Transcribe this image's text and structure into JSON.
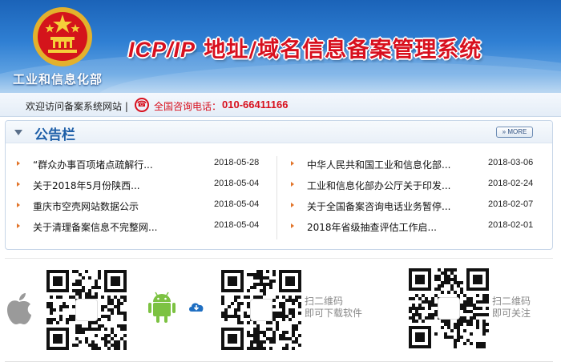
{
  "header": {
    "ministry_name": "工业和信息化部",
    "system_title_latin": "ICP/IP",
    "system_title_cn": " 地址/域名信息备案管理系统"
  },
  "welcome_bar": {
    "text": "欢迎访问备案系统网站 |",
    "hotline_label": "全国咨询电话：",
    "hotline_number": "010-66411166"
  },
  "notice": {
    "title": "公告栏",
    "more_label": "» MORE",
    "left_items": [
      {
        "title": "“群众办事百项堵点疏解行...",
        "date": "2018-05-28"
      },
      {
        "title": "关于2018年5月份陕西...",
        "date": "2018-05-04"
      },
      {
        "title": "重庆市空壳网站数据公示",
        "date": "2018-05-04"
      },
      {
        "title": "关于清理备案信息不完整网...",
        "date": "2018-05-04"
      }
    ],
    "right_items": [
      {
        "title": "中华人民共和国工业和信息化部...",
        "date": "2018-03-06"
      },
      {
        "title": "工业和信息化部办公厅关于印发...",
        "date": "2018-02-24"
      },
      {
        "title": "关于全国备案咨询电话业务暂停...",
        "date": "2018-02-07"
      },
      {
        "title": "2018年省级抽查评估工作启...",
        "date": "2018-02-01"
      }
    ]
  },
  "downloads": {
    "app_caption_line1": "扫二维码",
    "app_caption_line2": "即可下载软件",
    "follow_caption_line1": "扫二维码",
    "follow_caption_line2": "即可关注"
  },
  "icons": {
    "emblem": "national-emblem-icon",
    "phone": "phone-icon",
    "apple": "apple-icon",
    "android": "android-icon",
    "cloud": "cloud-download-icon"
  },
  "colors": {
    "header_blue": "#2f7fd3",
    "title_red": "#d8101e",
    "bullet_orange": "#e2752b",
    "android_green": "#7cc242"
  }
}
